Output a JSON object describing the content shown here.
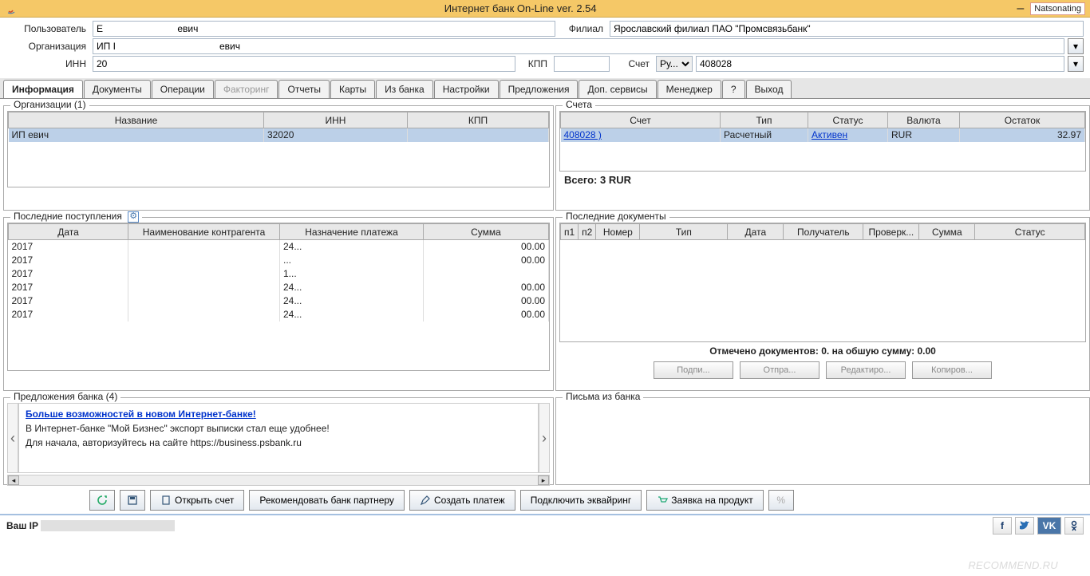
{
  "titlebar": {
    "title": "Интернет банк On-Line ver. 2.54",
    "user_tag": "Natsonating",
    "min": "–"
  },
  "header": {
    "user_label": "Пользователь",
    "user_value": "Е                            евич",
    "branch_label": "Филиал",
    "branch_value": "Ярославский филиал ПАО \"Промсвязьбанк\"",
    "org_label": "Организация",
    "org_value": "ИП І                                       евич",
    "inn_label": "ИНН",
    "inn_value": "20          ",
    "kpp_label": "КПП",
    "kpp_value": "",
    "acct_label": "Счет",
    "acct_curr": "Ру...",
    "acct_num": "408028                     "
  },
  "tabs": {
    "items": [
      {
        "label": "Информация",
        "active": true
      },
      {
        "label": "Документы"
      },
      {
        "label": "Операции"
      },
      {
        "label": "Факторинг",
        "disabled": true
      },
      {
        "label": "Отчеты"
      },
      {
        "label": "Карты"
      },
      {
        "label": "Из банка"
      },
      {
        "label": "Настройки"
      },
      {
        "label": "Предложения"
      },
      {
        "label": "Доп. сервисы"
      },
      {
        "label": "Менеджер"
      },
      {
        "label": "?"
      },
      {
        "label": "Выход"
      }
    ]
  },
  "orgs": {
    "title": "Организации (1)",
    "cols": {
      "name": "Название",
      "inn": "ИНН",
      "kpp": "КПП"
    },
    "rows": [
      {
        "name": "ИП                               евич",
        "inn": "32020               ",
        "kpp": ""
      }
    ]
  },
  "accounts": {
    "title": "Счета",
    "cols": {
      "acct": "Счет",
      "type": "Тип",
      "status": "Статус",
      "curr": "Валюта",
      "balance": "Остаток"
    },
    "rows": [
      {
        "acct": "408028                )",
        "type": "Расчетный",
        "status": "Активен",
        "curr": "RUR",
        "balance": "        32.97"
      }
    ],
    "total_label": "Всего:",
    "total_val": "3           RUR"
  },
  "incoming": {
    "title": "Последние поступления",
    "cols": {
      "date": "Дата",
      "name": "Наименование контрагента",
      "purpose": "Назначение платежа",
      "sum": "Сумма"
    },
    "rows": [
      {
        "date": "       2017",
        "name": "",
        "purpose": "                   24...",
        "sum": "        00.00"
      },
      {
        "date": "       2017",
        "name": "",
        "purpose": "                   ...",
        "sum": "        00.00"
      },
      {
        "date": "       2017",
        "name": "",
        "purpose": "                   1...",
        "sum": "        "
      },
      {
        "date": "       2017",
        "name": "",
        "purpose": "                   24...",
        "sum": "        00.00"
      },
      {
        "date": "       2017",
        "name": "",
        "purpose": "                   24...",
        "sum": "        00.00"
      },
      {
        "date": "       2017",
        "name": "",
        "purpose": "                   24...",
        "sum": "        00.00"
      }
    ]
  },
  "docs": {
    "title": "Последние документы",
    "cols": {
      "p1": "п1",
      "p2": "п2",
      "num": "Номер",
      "type": "Тип",
      "date": "Дата",
      "recv": "Получатель",
      "check": "Проверк...",
      "sum": "Сумма",
      "status": "Статус"
    },
    "summary": "Отмечено документов: 0. на обшую сумму: 0.00",
    "btns": {
      "sign": "Подпи...",
      "send": "Отпра...",
      "edit": "Редактиро...",
      "copy": "Копиров..."
    }
  },
  "offers": {
    "title": "Предложения банка (4)",
    "link": "Больше возможностей в новом Интернет-банке!",
    "line1": "В Интернет-банке \"Мой Бизнес\" экспорт выписки стал еще удобнее!",
    "line2": "Для начала, авторизуйтесь на сайте https://business.psbank.ru"
  },
  "mail": {
    "title": "Письма из банка"
  },
  "bottom": {
    "open_acct": "Открыть счет",
    "recommend": "Рекомендовать банк партнеру",
    "create_pay": "Создать платеж",
    "acquiring": "Подключить эквайринг",
    "product_req": "Заявка на продукт"
  },
  "status": {
    "ip_label": "Ваш IP"
  },
  "watermark": "RECOMMEND.RU"
}
